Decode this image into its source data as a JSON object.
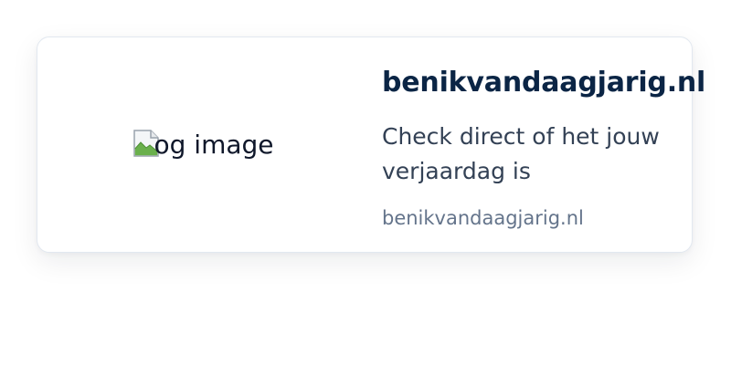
{
  "card": {
    "image_alt": "og image",
    "title": "benikvandaagjarig.nl",
    "description": "Check direct of het jouw verjaardag is",
    "domain": "benikvandaagjarig.nl"
  },
  "colors": {
    "title": "#0b2545",
    "description": "#334155",
    "domain": "#64748b",
    "border": "#e2e8f0"
  },
  "icons": {
    "image_placeholder": "broken-image-icon"
  }
}
